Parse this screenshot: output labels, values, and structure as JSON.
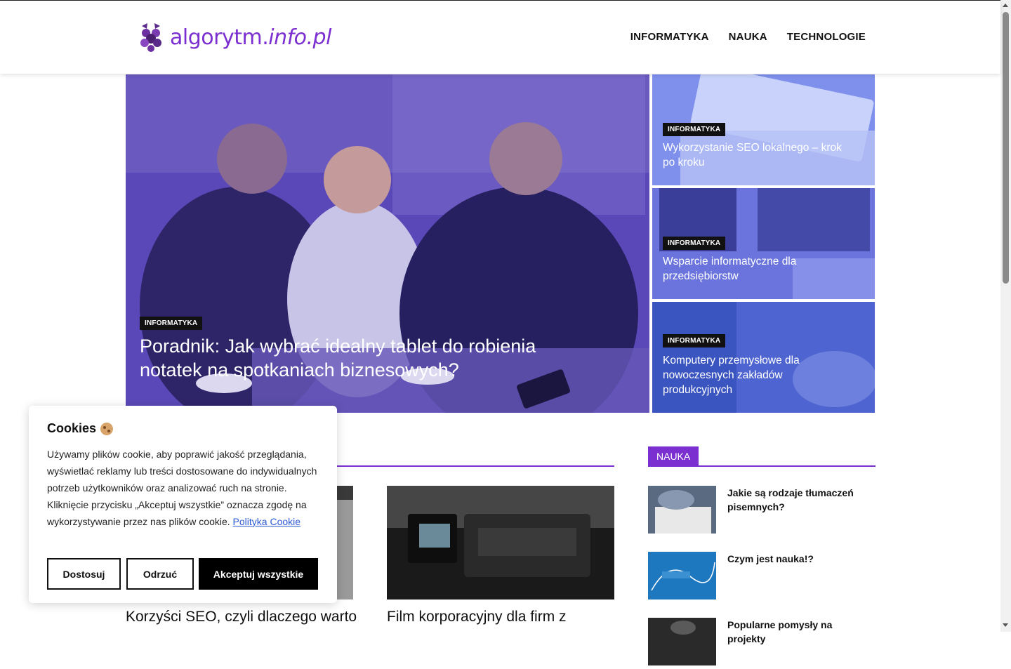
{
  "site": {
    "logo_text_main": "algorytm.",
    "logo_text_tld": "info.pl",
    "brand_color": "#7b2fd0"
  },
  "nav": {
    "items": [
      "INFORMATYKA",
      "NAUKA",
      "TECHNOLOGIE"
    ]
  },
  "hero": {
    "tag": "INFORMATYKA",
    "title": "Poradnik: Jak wybrać idealny tablet do robienia notatek na spotkaniach biznesowych?"
  },
  "side_cards": [
    {
      "tag": "INFORMATYKA",
      "title": "Wykorzystanie SEO lokalnego – krok po kroku"
    },
    {
      "tag": "INFORMATYKA",
      "title": "Wsparcie informatyczne dla przedsiębiorstw"
    },
    {
      "tag": "INFORMATYKA",
      "title": "Komputery przemysłowe dla nowoczesnych zakładów produkcyjnych"
    }
  ],
  "posts": [
    {
      "title": "Korzyści SEO, czyli dlaczego warto"
    },
    {
      "title": "Film korporacyjny dla firm z"
    }
  ],
  "sidebar": {
    "section_label": "NAUKA",
    "items": [
      {
        "title": "Jakie są rodzaje tłumaczeń pisemnych?"
      },
      {
        "title": "Czym jest nauka!?"
      },
      {
        "title": "Popularne pomysły na projekty"
      }
    ]
  },
  "cookie": {
    "title": "Cookies",
    "icon": "cookie-icon",
    "text": "Używamy plików cookie, aby poprawić jakość przeglądania, wyświetlać reklamy lub treści dostosowane do indywidualnych potrzeb użytkowników oraz analizować ruch na stronie. Kliknięcie przycisku „Akceptuj wszystkie” oznacza zgodę na wykorzystywanie przez nas plików cookie.",
    "link_text": "Polityka Cookie",
    "customize_label": "Dostosuj",
    "reject_label": "Odrzuć",
    "accept_label": "Akceptuj wszystkie"
  }
}
